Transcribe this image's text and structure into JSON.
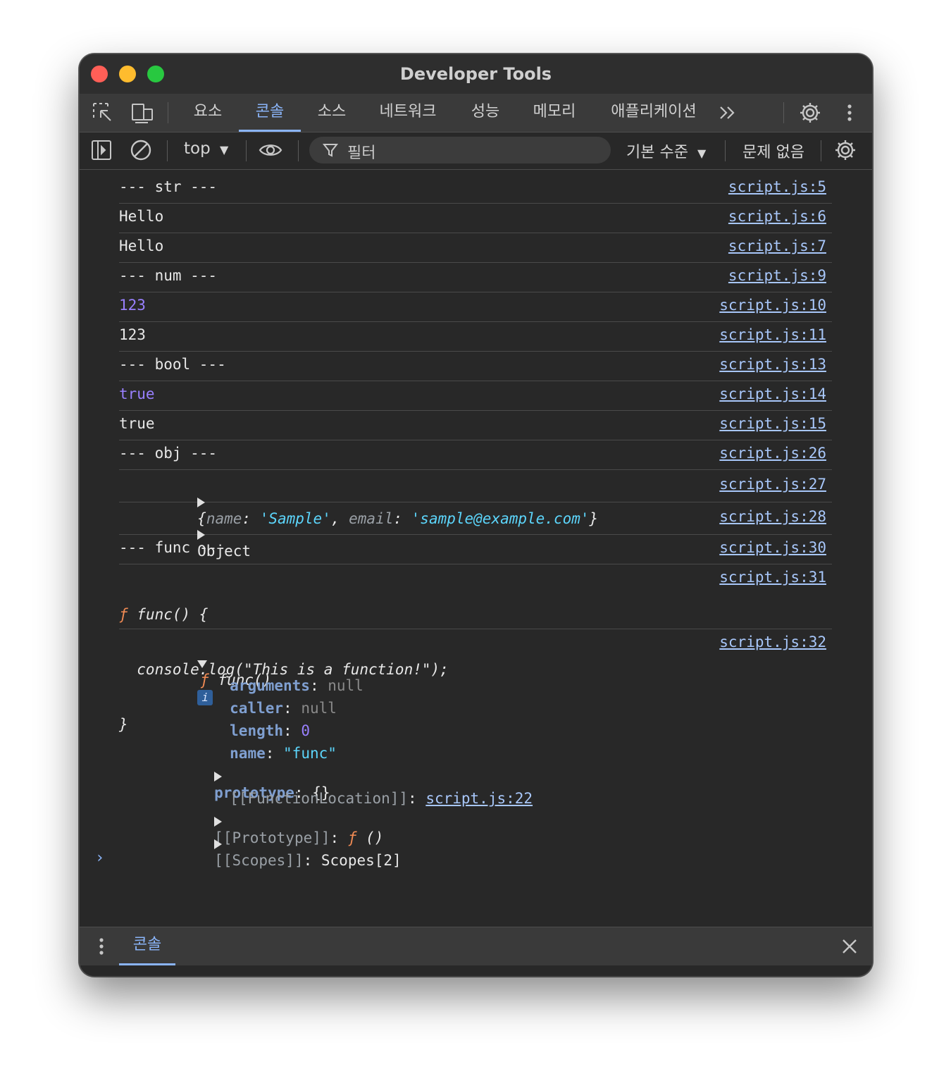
{
  "window": {
    "title": "Developer Tools"
  },
  "tabs": [
    "요소",
    "콘솔",
    "소스",
    "네트워크",
    "성능",
    "메모리",
    "애플리케이션"
  ],
  "toolbar": {
    "context": "top",
    "filter_placeholder": "필터",
    "level": "기본 수준",
    "issues": "문제 없음"
  },
  "console": {
    "rows": [
      {
        "text": "--- str ---",
        "src": "script.js:5"
      },
      {
        "text": "Hello",
        "src": "script.js:6"
      },
      {
        "text": "Hello",
        "src": "script.js:7"
      },
      {
        "text": "--- num ---",
        "src": "script.js:9"
      },
      {
        "text": "123",
        "src": "script.js:10"
      },
      {
        "text": "123",
        "src": "script.js:11"
      },
      {
        "text": "--- bool ---",
        "src": "script.js:13"
      },
      {
        "text": "true",
        "src": "script.js:14"
      },
      {
        "text": "true",
        "src": "script.js:15"
      },
      {
        "text": "--- obj ---",
        "src": "script.js:26"
      },
      {
        "src": "script.js:27",
        "obj": {
          "key1": "name",
          "val1": "'Sample'",
          "key2": "email",
          "val2": "'sample@example.com'"
        }
      },
      {
        "text": "Object",
        "src": "script.js:28"
      },
      {
        "text": "--- func ---",
        "src": "script.js:30"
      },
      {
        "src": "script.js:31",
        "lines": [
          "func() {",
          "  console.log(\"This is a function!\");",
          "}"
        ]
      },
      {
        "src": "script.js:32",
        "header": "func()"
      }
    ],
    "func_props": {
      "arguments_key": "arguments",
      "arguments_val": "null",
      "caller_key": "caller",
      "caller_val": "null",
      "length_key": "length",
      "length_val": "0",
      "name_key": "name",
      "name_val": "\"func\"",
      "prototype_key": "prototype",
      "prototype_val": "{}",
      "location_key": "[[FunctionLocation]]",
      "location_val": "script.js:22",
      "proto_key": "[[Prototype]]",
      "proto_val": "()",
      "scopes_key": "[[Scopes]]",
      "scopes_val": "Scopes[2]"
    }
  },
  "drawer": {
    "tab": "콘솔"
  }
}
